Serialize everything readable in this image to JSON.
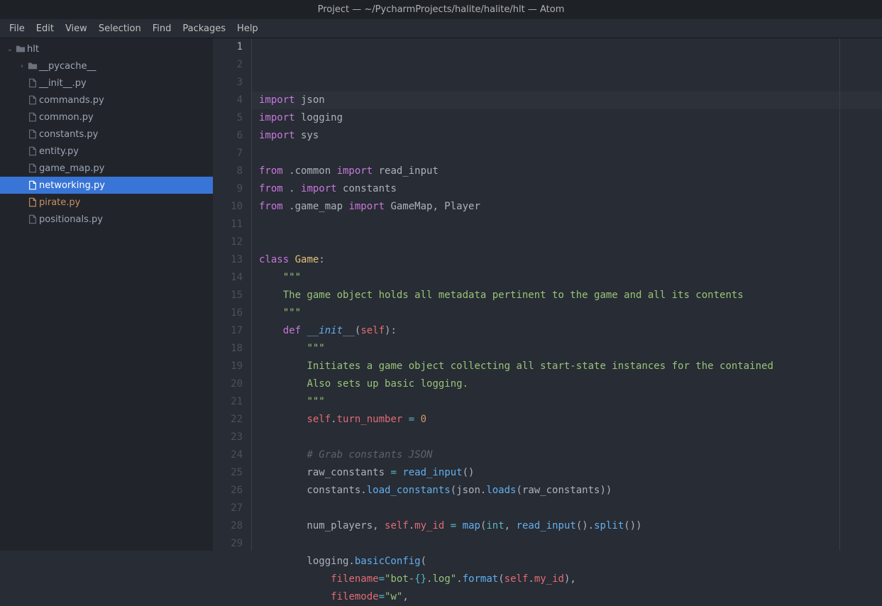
{
  "title": "Project — ~/PycharmProjects/halite/halite/hlt — Atom",
  "menu": [
    "File",
    "Edit",
    "View",
    "Selection",
    "Find",
    "Packages",
    "Help"
  ],
  "tree": {
    "root": {
      "name": "hlt",
      "expanded": true,
      "depth": 0,
      "type": "folder"
    },
    "entries": [
      {
        "name": "__pycache__",
        "type": "folder",
        "expanded": false,
        "depth": 1
      },
      {
        "name": "__init__.py",
        "type": "file",
        "depth": 1
      },
      {
        "name": "commands.py",
        "type": "file",
        "depth": 1
      },
      {
        "name": "common.py",
        "type": "file",
        "depth": 1
      },
      {
        "name": "constants.py",
        "type": "file",
        "depth": 1
      },
      {
        "name": "entity.py",
        "type": "file",
        "depth": 1
      },
      {
        "name": "game_map.py",
        "type": "file",
        "depth": 1
      },
      {
        "name": "networking.py",
        "type": "file",
        "depth": 1,
        "selected": true
      },
      {
        "name": "pirate.py",
        "type": "file",
        "depth": 1,
        "modified": true
      },
      {
        "name": "positionals.py",
        "type": "file",
        "depth": 1
      }
    ]
  },
  "editor": {
    "current_line": 1,
    "lines": [
      {
        "n": 1,
        "tokens": [
          {
            "t": "import",
            "c": "kw"
          },
          {
            "t": " json",
            "c": "mod"
          }
        ]
      },
      {
        "n": 2,
        "tokens": [
          {
            "t": "import",
            "c": "kw"
          },
          {
            "t": " logging",
            "c": "mod"
          }
        ]
      },
      {
        "n": 3,
        "tokens": [
          {
            "t": "import",
            "c": "kw"
          },
          {
            "t": " sys",
            "c": "mod"
          }
        ]
      },
      {
        "n": 4,
        "tokens": []
      },
      {
        "n": 5,
        "tokens": [
          {
            "t": "from",
            "c": "kw"
          },
          {
            "t": " .common ",
            "c": "mod"
          },
          {
            "t": "import",
            "c": "kw"
          },
          {
            "t": " read_input",
            "c": "mod"
          }
        ]
      },
      {
        "n": 6,
        "tokens": [
          {
            "t": "from",
            "c": "kw"
          },
          {
            "t": " . ",
            "c": "mod"
          },
          {
            "t": "import",
            "c": "kw"
          },
          {
            "t": " constants",
            "c": "mod"
          }
        ]
      },
      {
        "n": 7,
        "tokens": [
          {
            "t": "from",
            "c": "kw"
          },
          {
            "t": " .game_map ",
            "c": "mod"
          },
          {
            "t": "import",
            "c": "kw"
          },
          {
            "t": " GameMap, Player",
            "c": "mod"
          }
        ]
      },
      {
        "n": 8,
        "tokens": []
      },
      {
        "n": 9,
        "tokens": []
      },
      {
        "n": 10,
        "tokens": [
          {
            "t": "class",
            "c": "kw"
          },
          {
            "t": " ",
            "c": ""
          },
          {
            "t": "Game",
            "c": "cls"
          },
          {
            "t": ":",
            "c": ""
          }
        ]
      },
      {
        "n": 11,
        "tokens": [
          {
            "t": "    ",
            "c": ""
          },
          {
            "t": "\"\"\"",
            "c": "str"
          }
        ]
      },
      {
        "n": 12,
        "tokens": [
          {
            "t": "    ",
            "c": ""
          },
          {
            "t": "The game object holds all metadata pertinent to the game and all its contents",
            "c": "str"
          }
        ]
      },
      {
        "n": 13,
        "tokens": [
          {
            "t": "    ",
            "c": ""
          },
          {
            "t": "\"\"\"",
            "c": "str"
          }
        ]
      },
      {
        "n": 14,
        "tokens": [
          {
            "t": "    ",
            "c": ""
          },
          {
            "t": "def",
            "c": "kw"
          },
          {
            "t": " ",
            "c": ""
          },
          {
            "t": "__init__",
            "c": "mag"
          },
          {
            "t": "(",
            "c": ""
          },
          {
            "t": "self",
            "c": "self"
          },
          {
            "t": "):",
            "c": ""
          }
        ]
      },
      {
        "n": 15,
        "tokens": [
          {
            "t": "        ",
            "c": ""
          },
          {
            "t": "\"\"\"",
            "c": "str"
          }
        ]
      },
      {
        "n": 16,
        "tokens": [
          {
            "t": "        ",
            "c": ""
          },
          {
            "t": "Initiates a game object collecting all start-state instances for the contained",
            "c": "str"
          }
        ]
      },
      {
        "n": 17,
        "tokens": [
          {
            "t": "        ",
            "c": ""
          },
          {
            "t": "Also sets up basic logging.",
            "c": "str"
          }
        ]
      },
      {
        "n": 18,
        "tokens": [
          {
            "t": "        ",
            "c": ""
          },
          {
            "t": "\"\"\"",
            "c": "str"
          }
        ]
      },
      {
        "n": 19,
        "tokens": [
          {
            "t": "        ",
            "c": ""
          },
          {
            "t": "self",
            "c": "self"
          },
          {
            "t": ".",
            "c": ""
          },
          {
            "t": "turn_number",
            "c": "attr"
          },
          {
            "t": " ",
            "c": ""
          },
          {
            "t": "=",
            "c": "op"
          },
          {
            "t": " ",
            "c": ""
          },
          {
            "t": "0",
            "c": "num"
          }
        ]
      },
      {
        "n": 20,
        "tokens": []
      },
      {
        "n": 21,
        "tokens": [
          {
            "t": "        ",
            "c": ""
          },
          {
            "t": "# Grab constants JSON",
            "c": "cm"
          }
        ]
      },
      {
        "n": 22,
        "tokens": [
          {
            "t": "        raw_constants ",
            "c": ""
          },
          {
            "t": "=",
            "c": "op"
          },
          {
            "t": " ",
            "c": ""
          },
          {
            "t": "read_input",
            "c": "fn"
          },
          {
            "t": "()",
            "c": ""
          }
        ]
      },
      {
        "n": 23,
        "tokens": [
          {
            "t": "        constants.",
            "c": ""
          },
          {
            "t": "load_constants",
            "c": "fn"
          },
          {
            "t": "(json.",
            "c": ""
          },
          {
            "t": "loads",
            "c": "fn"
          },
          {
            "t": "(raw_constants))",
            "c": ""
          }
        ]
      },
      {
        "n": 24,
        "tokens": []
      },
      {
        "n": 25,
        "tokens": [
          {
            "t": "        num_players, ",
            "c": ""
          },
          {
            "t": "self",
            "c": "self"
          },
          {
            "t": ".",
            "c": ""
          },
          {
            "t": "my_id",
            "c": "attr"
          },
          {
            "t": " ",
            "c": ""
          },
          {
            "t": "=",
            "c": "op"
          },
          {
            "t": " ",
            "c": ""
          },
          {
            "t": "map",
            "c": "fn"
          },
          {
            "t": "(",
            "c": ""
          },
          {
            "t": "int",
            "c": "bi"
          },
          {
            "t": ", ",
            "c": ""
          },
          {
            "t": "read_input",
            "c": "fn"
          },
          {
            "t": "().",
            "c": ""
          },
          {
            "t": "split",
            "c": "fn"
          },
          {
            "t": "())",
            "c": ""
          }
        ]
      },
      {
        "n": 26,
        "tokens": []
      },
      {
        "n": 27,
        "tokens": [
          {
            "t": "        logging.",
            "c": ""
          },
          {
            "t": "basicConfig",
            "c": "fn"
          },
          {
            "t": "(",
            "c": ""
          }
        ]
      },
      {
        "n": 28,
        "tokens": [
          {
            "t": "            ",
            "c": ""
          },
          {
            "t": "filename",
            "c": "self"
          },
          {
            "t": "=",
            "c": "op"
          },
          {
            "t": "\"bot-",
            "c": "str"
          },
          {
            "t": "{}",
            "c": "bi"
          },
          {
            "t": ".log\"",
            "c": "str"
          },
          {
            "t": ".",
            "c": ""
          },
          {
            "t": "format",
            "c": "fn"
          },
          {
            "t": "(",
            "c": ""
          },
          {
            "t": "self",
            "c": "self"
          },
          {
            "t": ".",
            "c": ""
          },
          {
            "t": "my_id",
            "c": "attr"
          },
          {
            "t": "),",
            "c": ""
          }
        ]
      },
      {
        "n": 29,
        "tokens": [
          {
            "t": "            ",
            "c": ""
          },
          {
            "t": "filemode",
            "c": "self"
          },
          {
            "t": "=",
            "c": "op"
          },
          {
            "t": "\"w\"",
            "c": "str"
          },
          {
            "t": ",",
            "c": ""
          }
        ]
      }
    ]
  }
}
